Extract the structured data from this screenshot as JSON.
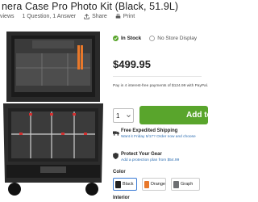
{
  "header": {
    "title": "nera Case Pro Photo Kit (Black, 51.9L)",
    "meta": {
      "reviews": "views",
      "qa": "1 Question, 1 Answer",
      "share": "Share",
      "print": "Print"
    }
  },
  "stock": {
    "status": "In Stock",
    "store": "No Store Display"
  },
  "price": "$499.95",
  "installments": "Pay in 4 interest-free payments of $124.99 with PayPal.",
  "purchase": {
    "quantity": "1",
    "add_label": "Add to"
  },
  "shipping": {
    "title": "Free Expedited Shipping",
    "sub": "Want it Friday 5/17? Order now and choose"
  },
  "protect": {
    "title": "Protect Your Gear",
    "sub": "Add a protection plan from $54.99"
  },
  "options": {
    "color_label": "Color",
    "colors": [
      {
        "name": "Black",
        "hex": "#222222",
        "selected": true
      },
      {
        "name": "Orange",
        "hex": "#e8782a",
        "selected": false
      },
      {
        "name": "Graph",
        "hex": "#6d6f72",
        "selected": false
      }
    ],
    "interior_label": "Interior"
  },
  "colors": {
    "accent": "#59a52c",
    "link": "#2b6cb0",
    "selected_border": "#3a7bd5"
  },
  "icons": [
    "chat-icon",
    "share-icon",
    "print-icon",
    "check-circle-icon",
    "store-icon",
    "truck-icon",
    "shield-icon",
    "chevron-down-icon"
  ]
}
